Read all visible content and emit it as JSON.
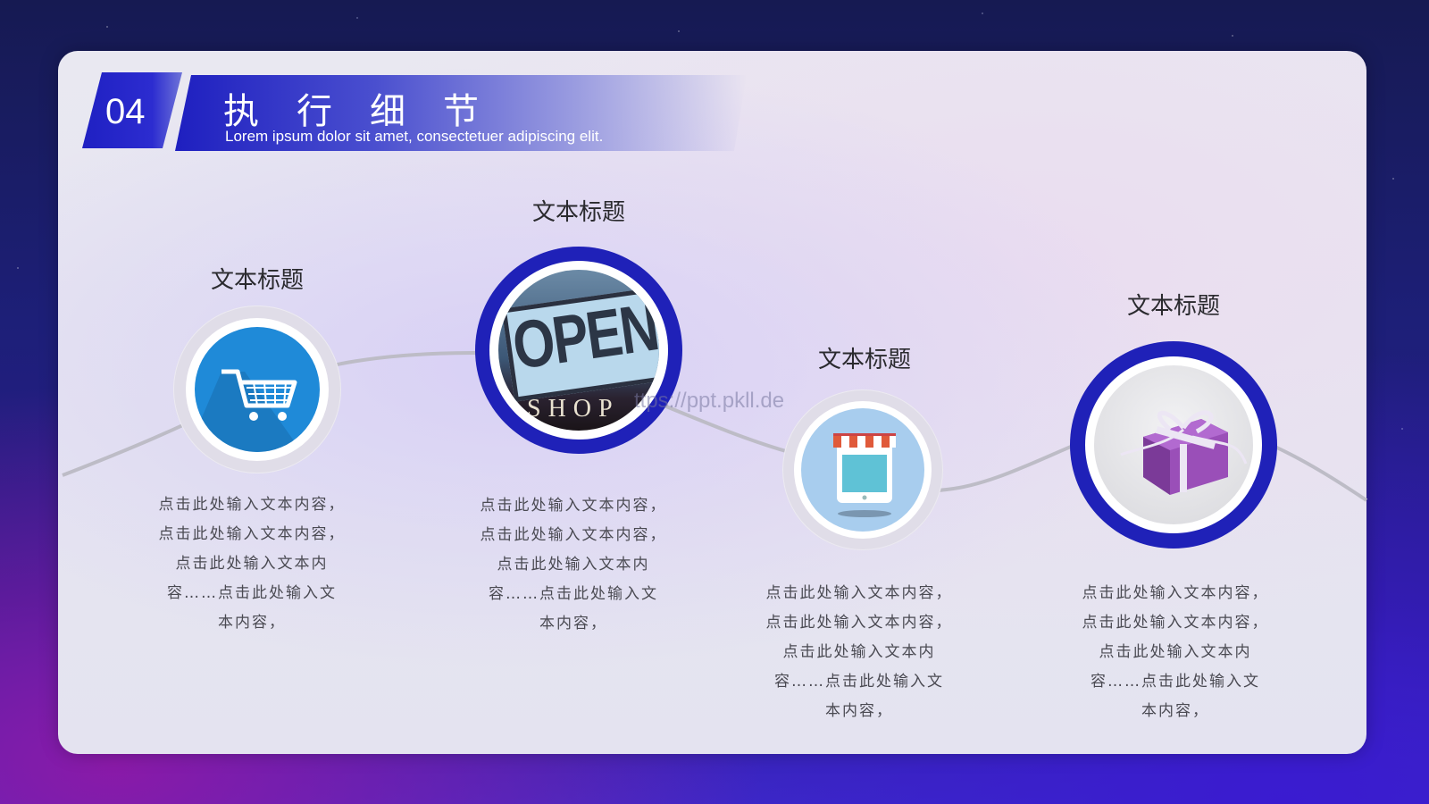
{
  "header": {
    "section_number": "04",
    "title": "执行细节",
    "subtitle": "Lorem ipsum dolor sit amet, consectetuer adipiscing elit."
  },
  "watermark": "ttps://ppt.pkll.de",
  "items": [
    {
      "title": "文本标题",
      "icon": "shopping-cart-icon",
      "desc": [
        "点击此处输入文本内容，",
        "点击此处输入文本内容，",
        "点击此处输入文本内",
        "容……点击此处输入文",
        "本内容，"
      ]
    },
    {
      "title": "文本标题",
      "icon": "open-shop-sign-photo",
      "image_text": [
        "OPEN",
        "SHOP"
      ],
      "desc": [
        "点击此处输入文本内容，",
        "点击此处输入文本内容，",
        "点击此处输入文本内",
        "容……点击此处输入文",
        "本内容，"
      ]
    },
    {
      "title": "文本标题",
      "icon": "storefront-tablet-icon",
      "desc": [
        "点击此处输入文本内容，",
        "点击此处输入文本内容，",
        "点击此处输入文本内",
        "容……点击此处输入文",
        "本内容，"
      ]
    },
    {
      "title": "文本标题",
      "icon": "gift-box-photo",
      "desc": [
        "点击此处输入文本内容，",
        "点击此处输入文本内容，",
        "点击此处输入文本内",
        "容……点击此处输入文",
        "本内容，"
      ]
    }
  ],
  "colors": {
    "accent_navy": "#1f21b8",
    "icon_blue": "#1f8ad8",
    "background_dark": "#1d1f78"
  }
}
